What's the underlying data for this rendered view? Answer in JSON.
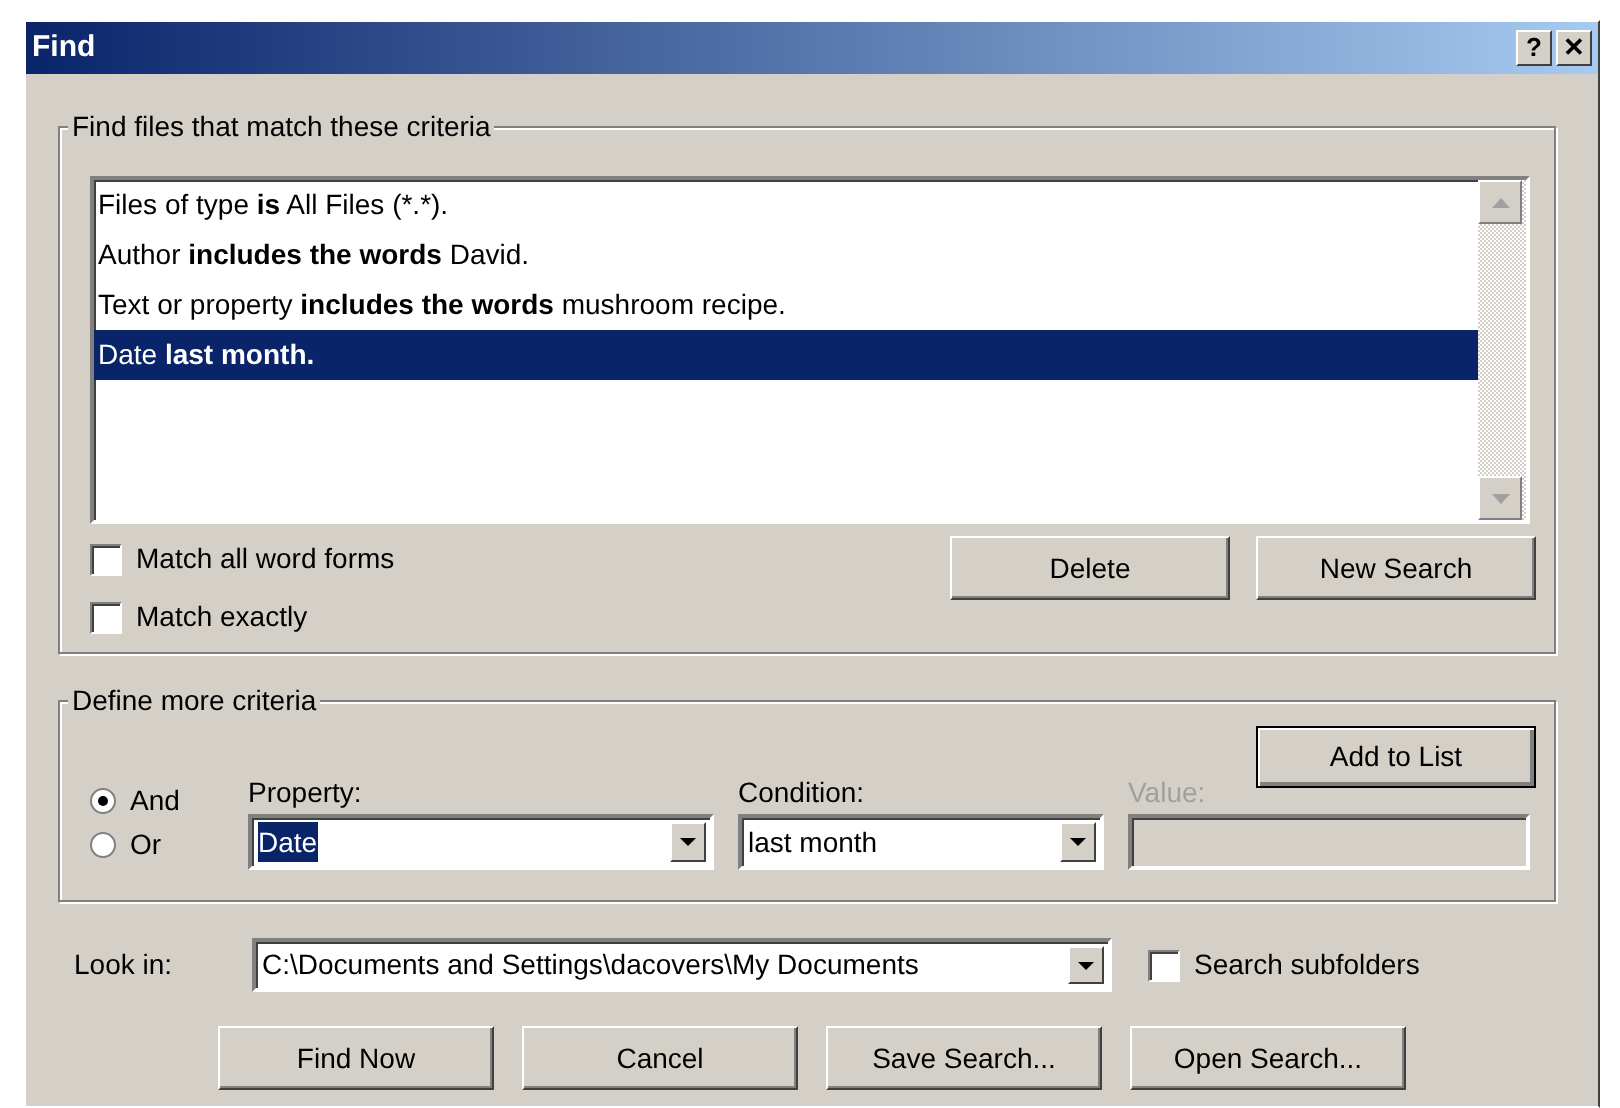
{
  "window": {
    "title": "Find",
    "title_buttons": [
      "?",
      "✕"
    ]
  },
  "criteria_group": {
    "title": "Find files that match these criteria",
    "items": [
      {
        "segments": [
          {
            "text": "Files of type ",
            "bold": false
          },
          {
            "text": "is",
            "bold": true
          },
          {
            "text": " All Files (*.*).",
            "bold": false
          }
        ],
        "selected": false
      },
      {
        "segments": [
          {
            "text": "Author ",
            "bold": false
          },
          {
            "text": "includes the words",
            "bold": true
          },
          {
            "text": " David.",
            "bold": false
          }
        ],
        "selected": false
      },
      {
        "segments": [
          {
            "text": "Text or property ",
            "bold": false
          },
          {
            "text": "includes the words",
            "bold": true
          },
          {
            "text": " mushroom recipe.",
            "bold": false
          }
        ],
        "selected": false
      },
      {
        "segments": [
          {
            "text": "Date ",
            "bold": false
          },
          {
            "text": "last month.",
            "bold": true
          }
        ],
        "selected": true
      }
    ],
    "options": [
      {
        "label": "Match all word forms",
        "checked": false
      },
      {
        "label": "Match exactly",
        "checked": false
      }
    ],
    "buttons": [
      "Delete",
      "New Search"
    ]
  },
  "more_criteria": {
    "title": "Define more criteria",
    "add_button": "Add to List",
    "operators": [
      {
        "label": "And",
        "selected": true
      },
      {
        "label": "Or",
        "selected": false
      }
    ],
    "property": {
      "label": "Property:",
      "value": "Date",
      "highlighted": true
    },
    "condition": {
      "label": "Condition:",
      "value": "last month"
    },
    "value": {
      "label": "Value:",
      "disabled": true
    }
  },
  "look_in": {
    "label": "Look in:",
    "value": "C:\\Documents and Settings\\dacovers\\My Documents",
    "search_subfolders": {
      "label": "Search subfolders",
      "checked": false
    }
  },
  "buttons": [
    "Find Now",
    "Cancel",
    "Save Search...",
    "Open Search..."
  ]
}
